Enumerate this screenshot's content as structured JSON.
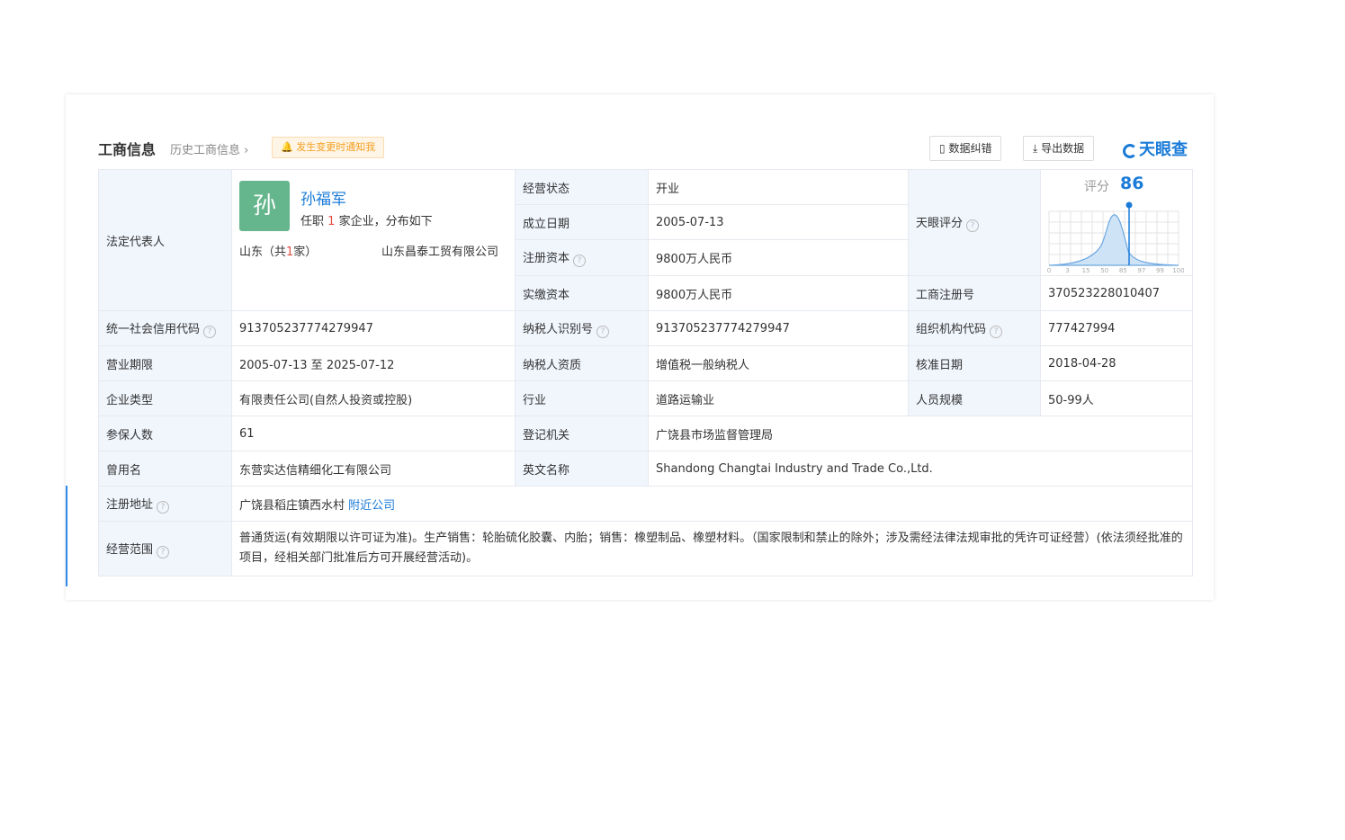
{
  "header": {
    "title": "工商信息",
    "history_link": "历史工商信息",
    "notify_label": "发生变更时通知我",
    "btn_correct": "数据纠错",
    "btn_export": "导出数据",
    "logo_text": "天眼查"
  },
  "legal": {
    "label": "法定代表人",
    "avatar_char": "孙",
    "name": "孙福军",
    "sub_prefix": "任职",
    "sub_count": "1",
    "sub_suffix": "家企业，分布如下",
    "region_prefix": "山东（共",
    "region_count": "1",
    "region_suffix": "家）",
    "company": "山东昌泰工贸有限公司"
  },
  "fields": {
    "status_label": "经营状态",
    "status_value": "开业",
    "founded_label": "成立日期",
    "founded_value": "2005-07-13",
    "reg_capital_label": "注册资本",
    "reg_capital_value": "9800万人民币",
    "paid_capital_label": "实缴资本",
    "paid_capital_value": "9800万人民币",
    "score_label": "天眼评分",
    "reg_no_label": "工商注册号",
    "reg_no_value": "370523228010407",
    "credit_code_label": "统一社会信用代码",
    "credit_code_value": "913705237774279947",
    "taxpayer_id_label": "纳税人识别号",
    "taxpayer_id_value": "913705237774279947",
    "org_code_label": "组织机构代码",
    "org_code_value": "777427994",
    "term_label": "营业期限",
    "term_value": "2005-07-13  至 2025-07-12",
    "taxpayer_type_label": "纳税人资质",
    "taxpayer_type_value": "增值税一般纳税人",
    "approval_label": "核准日期",
    "approval_value": "2018-04-28",
    "ent_type_label": "企业类型",
    "ent_type_value": "有限责任公司(自然人投资或控股)",
    "industry_label": "行业",
    "industry_value": "道路运输业",
    "staff_label": "人员规模",
    "staff_value": "50-99人",
    "insured_label": "参保人数",
    "insured_value": "61",
    "authority_label": "登记机关",
    "authority_value": "广饶县市场监督管理局",
    "former_name_label": "曾用名",
    "former_name_value": "东营实达信精细化工有限公司",
    "english_label": "英文名称",
    "english_value": "Shandong Changtai Industry and Trade Co.,Ltd.",
    "address_label": "注册地址",
    "address_value": "广饶县稻庄镇西水村",
    "address_link": "附近公司",
    "scope_label": "经营范围",
    "scope_value": "普通货运(有效期限以许可证为准)。生产销售：轮胎硫化胶囊、内胎；销售：橡塑制品、橡塑材料。（国家限制和禁止的除外；涉及需经法律法规审批的凭许可证经营）(依法须经批准的项目，经相关部门批准后方可开展经营活动)。"
  },
  "score": {
    "label": "评分",
    "value": "86",
    "value_num": 86,
    "axis_ticks": [
      "0",
      "3",
      "15",
      "50",
      "85",
      "97",
      "99",
      "100"
    ]
  },
  "colors": {
    "accent": "#1a7bd8",
    "label_bg": "#f1f6fd",
    "avatar": "#65b68d",
    "notify": "#f3a024",
    "highlight": "#e54d42"
  }
}
